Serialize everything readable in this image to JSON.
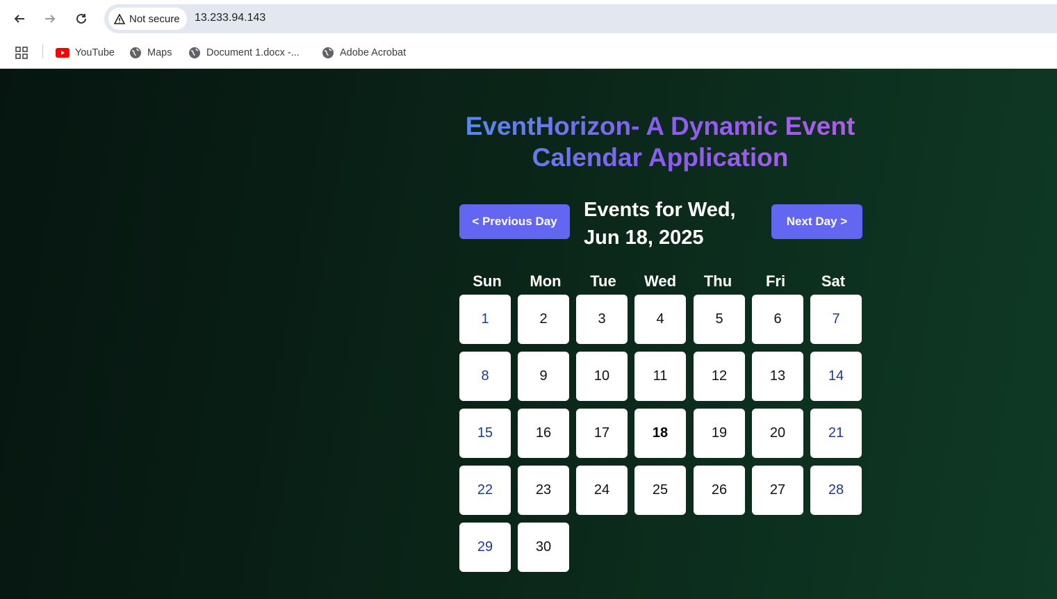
{
  "browser": {
    "security_label": "Not secure",
    "url": "13.233.94.143",
    "bookmarks": [
      {
        "label": "YouTube",
        "icon": "youtube-icon"
      },
      {
        "label": "Maps",
        "icon": "globe-icon"
      },
      {
        "label": "Document 1.docx -...",
        "icon": "globe-icon"
      },
      {
        "label": "Adobe Acrobat",
        "icon": "globe-icon"
      }
    ]
  },
  "app": {
    "title_line1": "EventHorizon- A Dynamic Event",
    "title_line2": "Calendar Application",
    "prev_label": "< Previous Day",
    "next_label": "Next Day >",
    "events_heading_line1": "Events for Wed,",
    "events_heading_line2": "Jun 18, 2025",
    "accent_color": "#6366f1",
    "selected_day": 18
  },
  "calendar": {
    "weekdays": [
      "Sun",
      "Mon",
      "Tue",
      "Wed",
      "Thu",
      "Fri",
      "Sat"
    ],
    "days": [
      "1",
      "2",
      "3",
      "4",
      "5",
      "6",
      "7",
      "8",
      "9",
      "10",
      "11",
      "12",
      "13",
      "14",
      "15",
      "16",
      "17",
      "18",
      "19",
      "20",
      "21",
      "22",
      "23",
      "24",
      "25",
      "26",
      "27",
      "28",
      "29",
      "30"
    ]
  }
}
